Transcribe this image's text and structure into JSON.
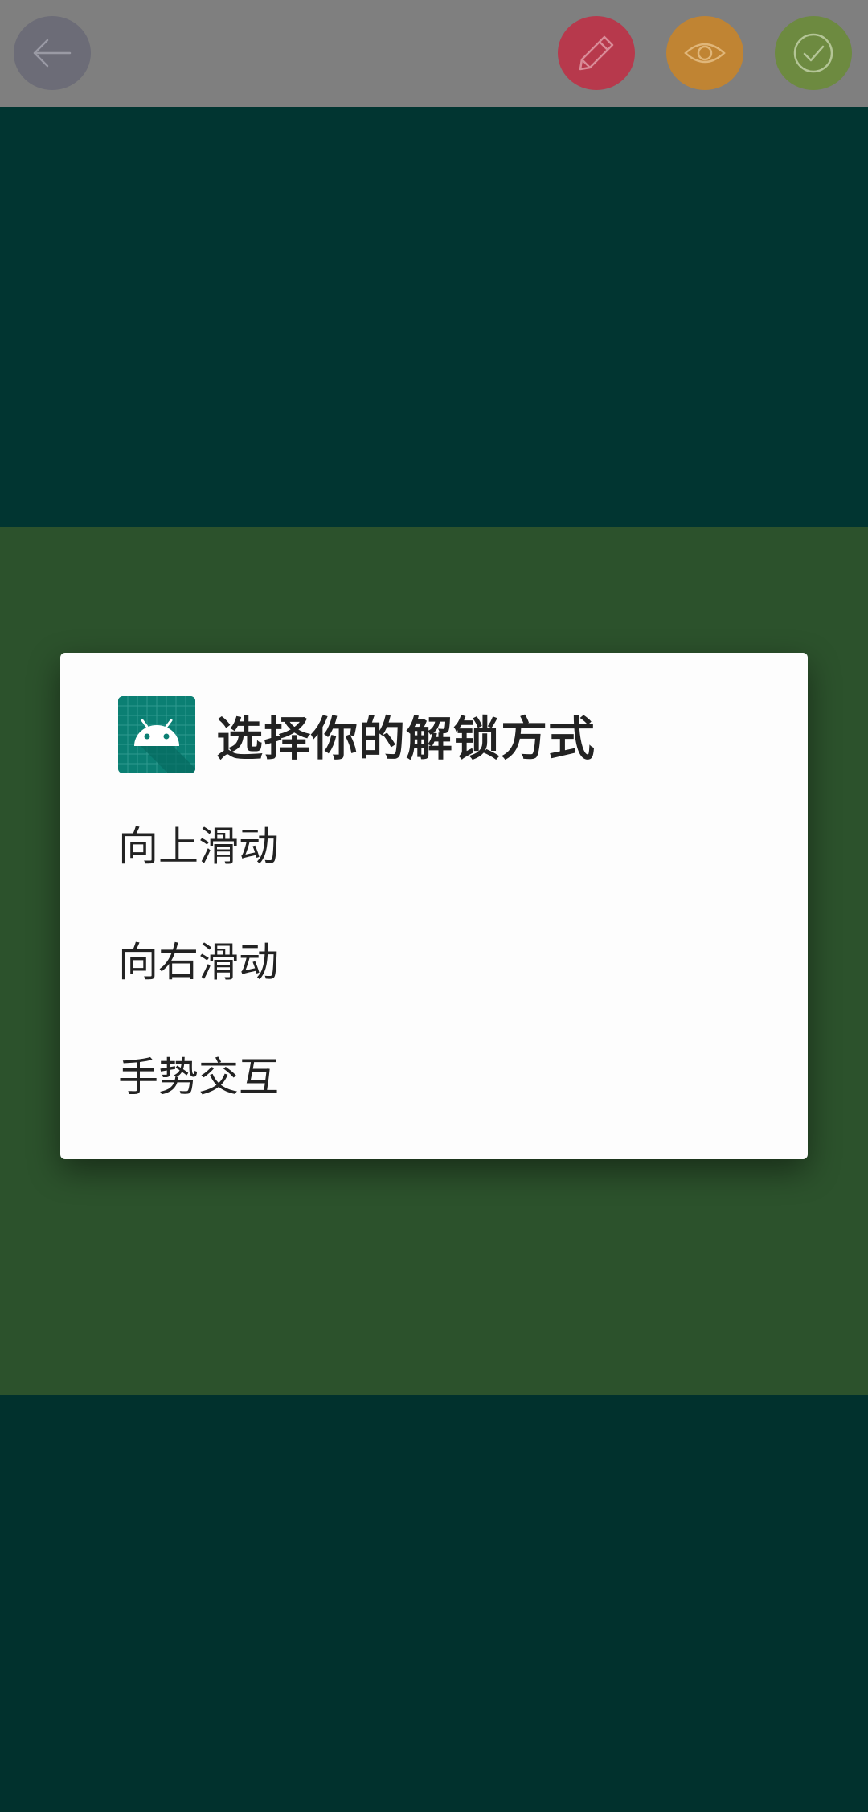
{
  "toolbar": {
    "back_icon": "arrow-left-icon",
    "edit_icon": "pencil-icon",
    "view_icon": "eye-icon",
    "done_icon": "check-circle-icon",
    "colors": {
      "bar": "#7f7f7f",
      "back": "#6c6c77",
      "edit": "#b7394c",
      "view": "#c08433",
      "done": "#6d8a40"
    }
  },
  "dialog": {
    "icon": "android-app-icon",
    "title": "选择你的解锁方式",
    "options": [
      {
        "label": "向上滑动"
      },
      {
        "label": "向右滑动"
      },
      {
        "label": "手势交互"
      }
    ]
  },
  "colors": {
    "background_dark": "#013531",
    "background_green": "#2c522c"
  }
}
